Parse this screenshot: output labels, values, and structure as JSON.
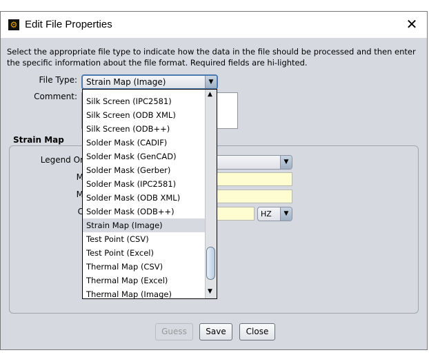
{
  "window": {
    "title": "Edit File Properties",
    "close_label": "✕"
  },
  "instructions": "Select the appropriate file type to indicate how the data in the file should be processed and then enter the specific information about the file format. Required fields are hi-lighted.",
  "file_type": {
    "label": "File Type:",
    "value": "Strain Map (Image)"
  },
  "comment": {
    "label": "Comment:",
    "value": ""
  },
  "group": {
    "title": "Strain Map",
    "labels": [
      "Legend Or",
      "M",
      "M",
      "C"
    ],
    "unit": "HZ"
  },
  "dropdown": {
    "items": [
      "Silk Screen (IPC2581)",
      "Silk Screen (ODB XML)",
      "Silk Screen (ODB++)",
      "Solder Mask (CADIF)",
      "Solder Mask (GenCAD)",
      "Solder Mask (Gerber)",
      "Solder Mask (IPC2581)",
      "Solder Mask (ODB XML)",
      "Solder Mask (ODB++)",
      "Strain Map (Image)",
      "Test Point (CSV)",
      "Test Point (Excel)",
      "Thermal Map (CSV)",
      "Thermal Map (Excel)",
      "Thermal Map (Image)"
    ],
    "selected_index": 9
  },
  "buttons": {
    "guess": "Guess",
    "save": "Save",
    "close": "Close"
  }
}
